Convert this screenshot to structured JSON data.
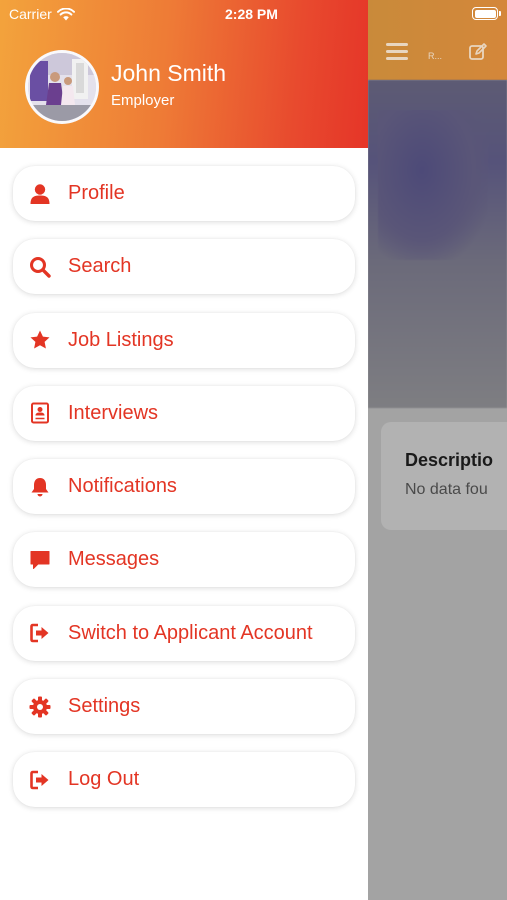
{
  "status_bar": {
    "carrier": "Carrier",
    "time": "2:28 PM",
    "icons": [
      "wifi-icon",
      "battery-icon"
    ]
  },
  "drawer": {
    "user": {
      "name": "John Smith",
      "role": "Employer",
      "avatar": "profile-photo"
    },
    "menu_items": [
      {
        "label": "Profile",
        "icon": "user-icon"
      },
      {
        "label": "Search",
        "icon": "search-icon"
      },
      {
        "label": "Job Listings",
        "icon": "star-icon"
      },
      {
        "label": "Interviews",
        "icon": "id-card-icon"
      },
      {
        "label": "Notifications",
        "icon": "bell-icon"
      },
      {
        "label": "Messages",
        "icon": "message-icon"
      },
      {
        "label": "Switch to Applicant Account",
        "icon": "sign-out-icon"
      },
      {
        "label": "Settings",
        "icon": "gear-icon"
      },
      {
        "label": "Log Out",
        "icon": "sign-out-icon"
      }
    ]
  },
  "background_page": {
    "header_title": "R...",
    "description_title": "Descriptio",
    "description_text": "No data fou",
    "icons": [
      "menu-icon",
      "edit-icon"
    ]
  },
  "colors": {
    "accent": "#e33524",
    "header_gradient_start": "#f3a33c",
    "header_gradient_end": "#e53528",
    "overlay": "#a3a3a3"
  }
}
